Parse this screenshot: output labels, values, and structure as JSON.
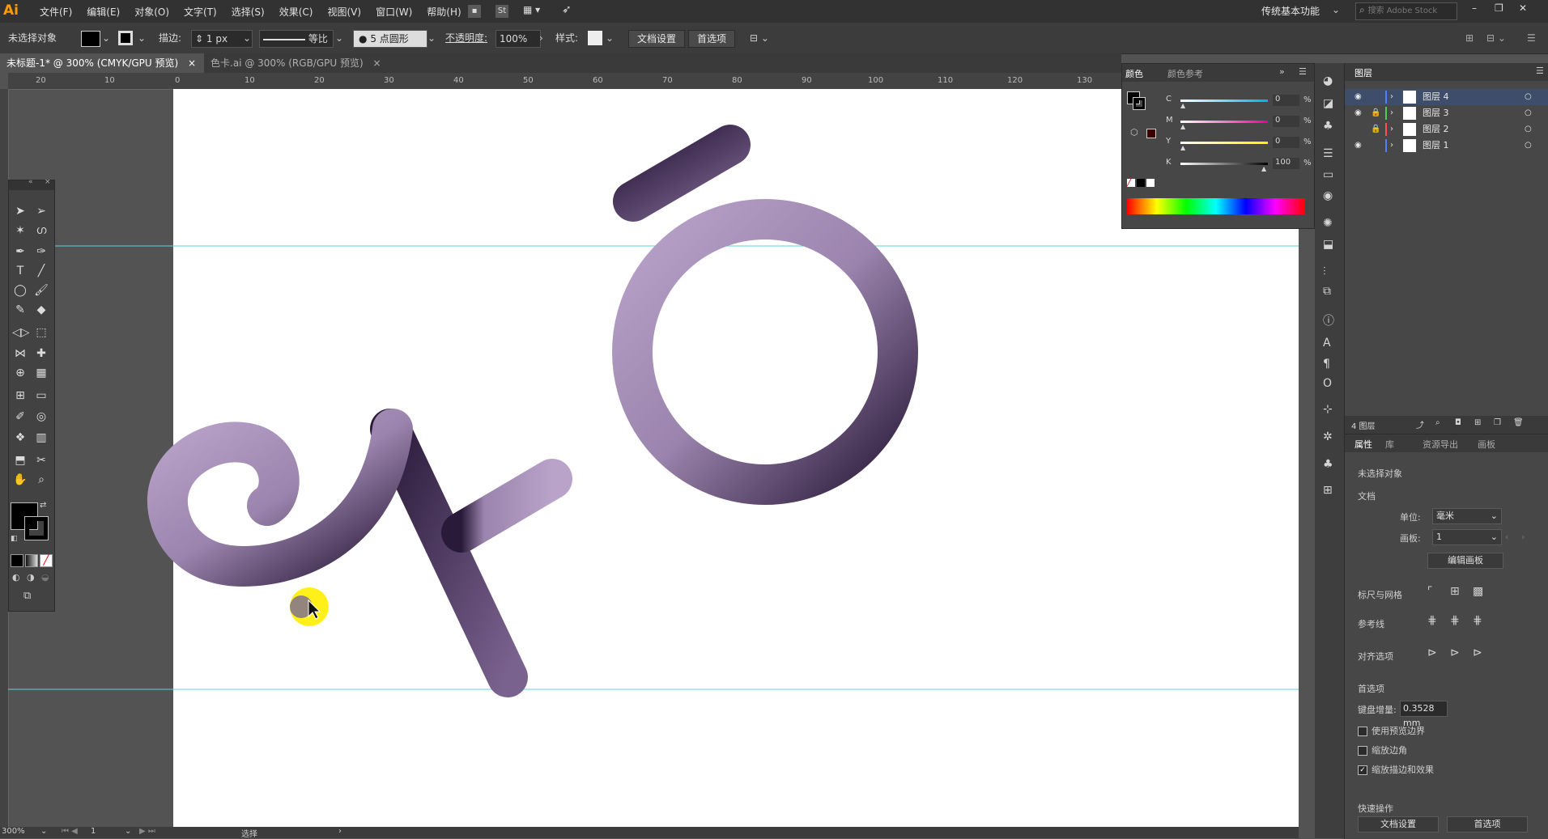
{
  "app": {
    "logo": "Ai"
  },
  "menu": [
    "文件(F)",
    "编辑(E)",
    "对象(O)",
    "文字(T)",
    "选择(S)",
    "效果(C)",
    "视图(V)",
    "窗口(W)",
    "帮助(H)"
  ],
  "menu_icons": {
    "st": "St"
  },
  "workspace": {
    "label": "传统基本功能",
    "search_placeholder": "搜索 Adobe Stock"
  },
  "control": {
    "selection": "未选择对象",
    "stroke_label": "描边:",
    "stroke_value": "1 px",
    "profile": "等比",
    "brush": "5 点圆形",
    "opacity_label": "不透明度:",
    "opacity_value": "100%",
    "style_label": "样式:",
    "doc_setup": "文档设置",
    "prefs": "首选项"
  },
  "tabs": [
    {
      "label": "未标题-1* @ 300% (CMYK/GPU 预览)",
      "close": "×"
    },
    {
      "label": "色卡.ai @ 300% (RGB/GPU 预览)",
      "close": "×"
    }
  ],
  "ruler": [
    "20",
    "10",
    "0",
    "10",
    "20",
    "30",
    "40",
    "50",
    "60",
    "70",
    "80",
    "90",
    "100",
    "110",
    "120",
    "130"
  ],
  "color_panel": {
    "tabs": [
      "颜色",
      "颜色参考"
    ],
    "channels": [
      {
        "name": "C",
        "value": "0",
        "unit": "%"
      },
      {
        "name": "M",
        "value": "0",
        "unit": "%"
      },
      {
        "name": "Y",
        "value": "0",
        "unit": "%"
      },
      {
        "name": "K",
        "value": "100",
        "unit": "%"
      }
    ]
  },
  "layers_panel": {
    "title": "图层",
    "layers": [
      {
        "name": "图层 4",
        "color": "#4f7fff"
      },
      {
        "name": "图层 3",
        "color": "#4fcf4f"
      },
      {
        "name": "图层 2",
        "color": "#ff4f4f"
      },
      {
        "name": "图层 1",
        "color": "#4f7fff"
      }
    ],
    "count": "4 图层"
  },
  "properties": {
    "tabs": [
      "属性",
      "库",
      "资源导出",
      "画板"
    ],
    "selection": "未选择对象",
    "doc_label": "文档",
    "unit_label": "单位:",
    "unit_value": "毫米",
    "artboard_label": "画板:",
    "artboard_value": "1",
    "edit_artboard": "编辑画板",
    "ruler_grid": "标尺与网格",
    "guides": "参考线",
    "snap": "对齐选项",
    "prefs_section": "首选项",
    "keyboard_inc_label": "键盘增量:",
    "keyboard_inc_value": "0.3528 mm",
    "check_preview_bounds": "使用预览边界",
    "check_scale_corners": "缩放边角",
    "check_scale_strokes": "缩放描边和效果",
    "quick_actions": "快速操作",
    "doc_setup": "文档设置",
    "prefs": "首选项"
  },
  "status": {
    "zoom": "300%",
    "artboard": "1",
    "tool": "选择"
  },
  "colors": {
    "stroke_dark": "#2a1a3a",
    "stroke_light": "#b9a3c9"
  }
}
